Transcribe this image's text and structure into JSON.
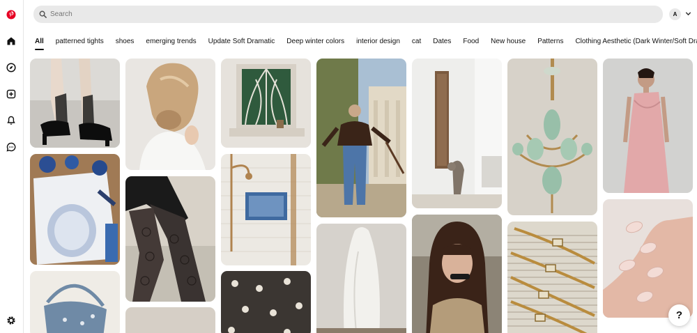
{
  "search": {
    "placeholder": "Search"
  },
  "user": {
    "avatar_letter": "A"
  },
  "brand_color": "#e60023",
  "sidebar": {
    "items": [
      {
        "name": "pinterest-logo-icon"
      },
      {
        "name": "home-icon"
      },
      {
        "name": "explore-compass-icon"
      },
      {
        "name": "create-plus-icon"
      },
      {
        "name": "notifications-bell-icon"
      },
      {
        "name": "messages-chat-icon"
      },
      {
        "name": "settings-gear-icon"
      }
    ]
  },
  "tabs": [
    {
      "label": "All",
      "active": true
    },
    {
      "label": "patterned tights"
    },
    {
      "label": "shoes"
    },
    {
      "label": "emerging trends"
    },
    {
      "label": "Update Soft Dramatic"
    },
    {
      "label": "Deep winter colors"
    },
    {
      "label": "interior design"
    },
    {
      "label": "cat"
    },
    {
      "label": "Dates"
    },
    {
      "label": "Food"
    },
    {
      "label": "New house"
    },
    {
      "label": "Patterns"
    },
    {
      "label": "Clothing Aesthetic (Dark Winter/Soft Dramatic)"
    }
  ],
  "pins": [
    {
      "subject": "black mary jane heels with black socks"
    },
    {
      "subject": "blonde low bun hairstyle"
    },
    {
      "subject": "art deco stained glass window"
    },
    {
      "subject": "woman in brown leather jacket and flared jeans"
    },
    {
      "subject": "cat using wall scratching post"
    },
    {
      "subject": "sage green vintage chandelier"
    },
    {
      "subject": "pink draped midi dress"
    },
    {
      "subject": "blue and white pottery painting"
    },
    {
      "subject": "black lace patterned tights"
    },
    {
      "subject": "shower with blue tile inset"
    },
    {
      "subject": "white draped sculpture"
    },
    {
      "subject": "woman with bangs and sunglasses"
    },
    {
      "subject": "vintage gold watches"
    },
    {
      "subject": "light pink manicure nails"
    },
    {
      "subject": "blue embellished shoulder bag"
    },
    {
      "subject": "beige pin"
    },
    {
      "subject": "dark floral tile floor"
    }
  ],
  "help": {
    "label": "?"
  }
}
